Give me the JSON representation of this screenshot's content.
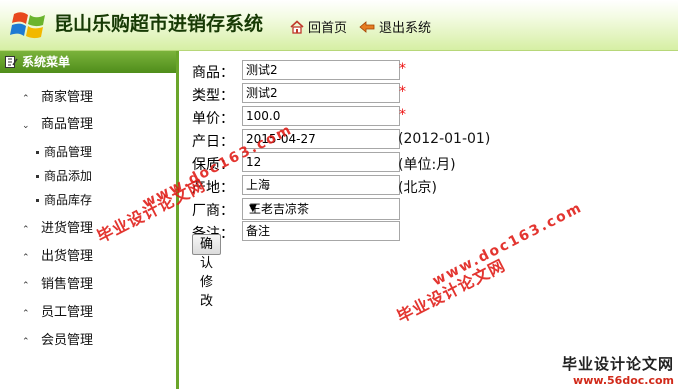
{
  "app": {
    "title": "昆山乐购超市进销存系统"
  },
  "nav": {
    "home": "回首页",
    "exit": "退出系统"
  },
  "sidebar": {
    "header": "系统菜单",
    "items": [
      {
        "label": "商家管理",
        "expanded": false
      },
      {
        "label": "商品管理",
        "expanded": true,
        "children": [
          "商品管理",
          "商品添加",
          "商品库存"
        ]
      },
      {
        "label": "进货管理",
        "expanded": false
      },
      {
        "label": "出货管理",
        "expanded": false
      },
      {
        "label": "销售管理",
        "expanded": false
      },
      {
        "label": "员工管理",
        "expanded": false
      },
      {
        "label": "会员管理",
        "expanded": false
      }
    ]
  },
  "form": {
    "product": {
      "label": "商品：",
      "value": "测试2",
      "required": "*"
    },
    "type": {
      "label": "类型：",
      "value": "测试2",
      "required": "*"
    },
    "price": {
      "label": "单价：",
      "value": "100.0",
      "required": "*"
    },
    "date": {
      "label": "产日：",
      "value": "2015-04-27",
      "hint": "(2012-01-01)"
    },
    "shelf": {
      "label": "保质：",
      "value": "12",
      "hint": "(单位:月)"
    },
    "origin": {
      "label": "产地：",
      "value": "上海",
      "hint": "(北京)"
    },
    "vendor": {
      "label": "厂商：",
      "selected": "王老吉凉茶"
    },
    "note": {
      "label": "备注：",
      "value": "备注"
    },
    "submit": "确认修改"
  },
  "watermarks": {
    "text": "毕业设计论文网",
    "url": "www.doc163.com",
    "corner_title": "毕业设计论文网",
    "corner_url": "www.56doc.com"
  },
  "colors": {
    "accent": "#5b9a22",
    "watermark": "#e0201a",
    "required": "#e11111"
  }
}
